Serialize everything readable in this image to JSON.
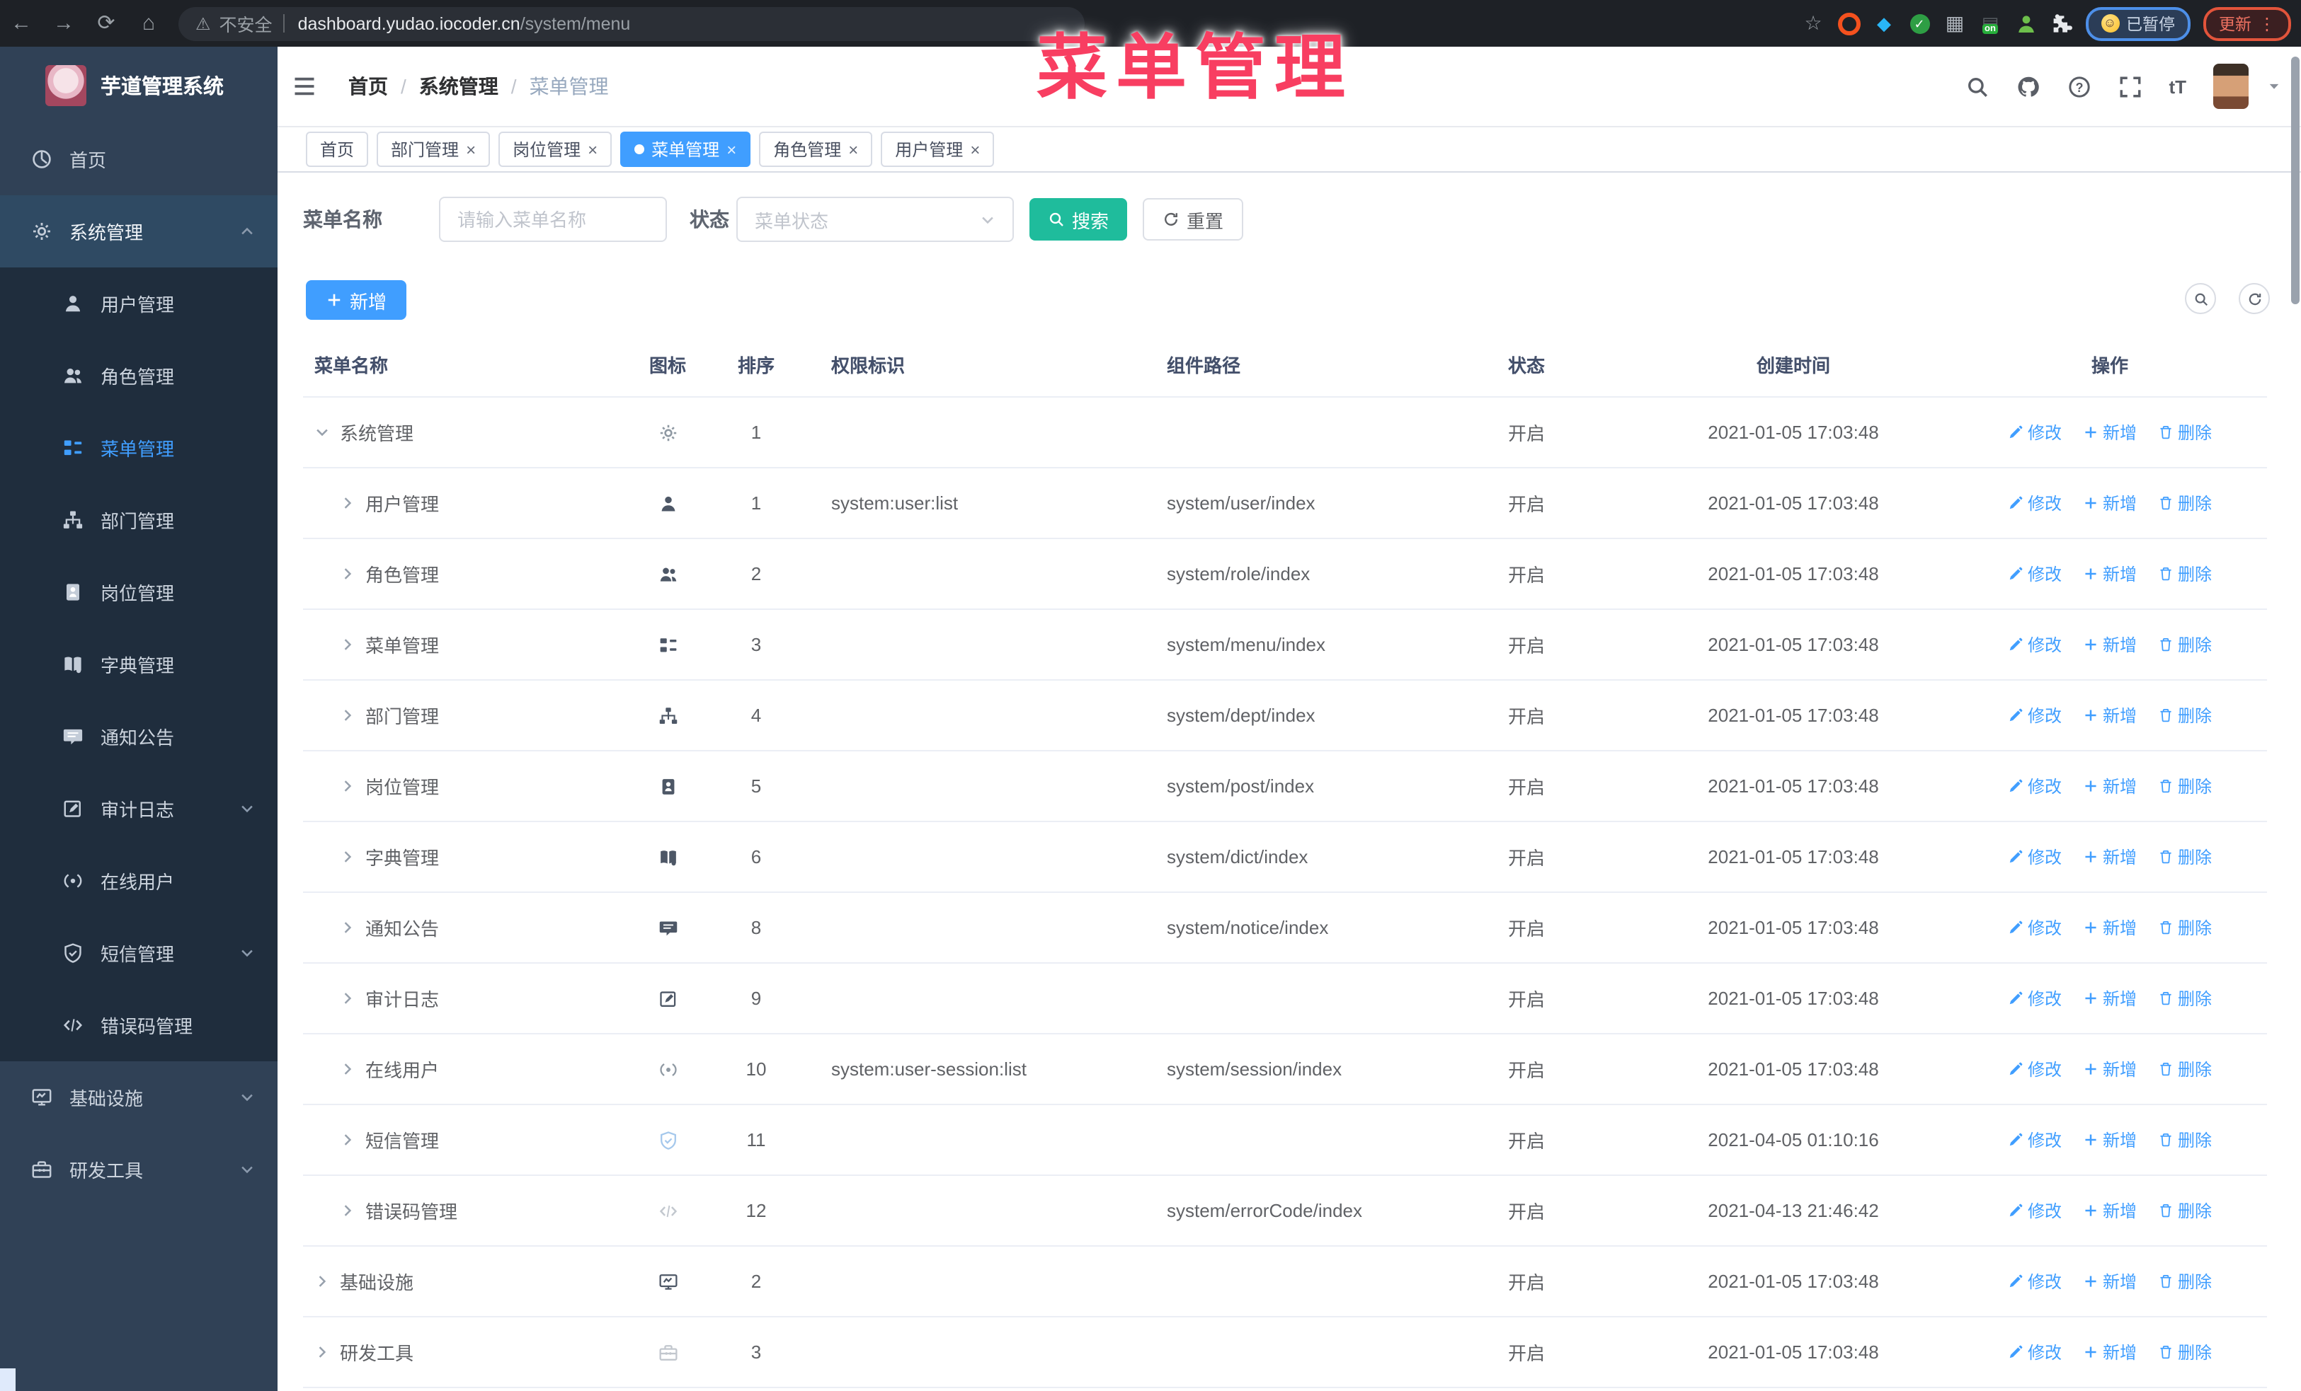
{
  "browser": {
    "security_label": "不安全",
    "url_domain": "dashboard.yudao.iocoder.cn",
    "url_path": "/system/menu",
    "paused_label": "已暂停",
    "update_label": "更新",
    "on_badge": "on"
  },
  "overlay": {
    "title": "菜单管理",
    "color": "#f83e61"
  },
  "sidebar": {
    "logo_title": "芋道管理系统",
    "items": [
      {
        "key": "home",
        "label": "首页",
        "icon": "dashboard",
        "level": 1
      },
      {
        "key": "system",
        "label": "系统管理",
        "icon": "gear",
        "level": 1,
        "arrow": "up",
        "parent_active": true
      },
      {
        "key": "user",
        "label": "用户管理",
        "icon": "user",
        "level": 2
      },
      {
        "key": "role",
        "label": "角色管理",
        "icon": "users",
        "level": 2
      },
      {
        "key": "menu",
        "label": "菜单管理",
        "icon": "tree",
        "level": 2,
        "active": true
      },
      {
        "key": "dept",
        "label": "部门管理",
        "icon": "org",
        "level": 2
      },
      {
        "key": "post",
        "label": "岗位管理",
        "icon": "badge",
        "level": 2
      },
      {
        "key": "dict",
        "label": "字典管理",
        "icon": "book",
        "level": 2
      },
      {
        "key": "notice",
        "label": "通知公告",
        "icon": "message",
        "level": 2
      },
      {
        "key": "audit",
        "label": "审计日志",
        "icon": "edit",
        "level": 2,
        "arrow": "down"
      },
      {
        "key": "online",
        "label": "在线用户",
        "icon": "link",
        "level": 2
      },
      {
        "key": "sms",
        "label": "短信管理",
        "icon": "shield",
        "level": 2,
        "arrow": "down"
      },
      {
        "key": "errcode",
        "label": "错误码管理",
        "icon": "code",
        "level": 2
      },
      {
        "key": "infra",
        "label": "基础设施",
        "icon": "monitor",
        "level": 1,
        "arrow": "down"
      },
      {
        "key": "tools",
        "label": "研发工具",
        "icon": "toolbox",
        "level": 1,
        "arrow": "down"
      }
    ]
  },
  "header": {
    "breadcrumb": [
      "首页",
      "系统管理",
      "菜单管理"
    ]
  },
  "tabs": [
    {
      "label": "首页",
      "closable": false,
      "active": false
    },
    {
      "label": "部门管理",
      "closable": true,
      "active": false
    },
    {
      "label": "岗位管理",
      "closable": true,
      "active": false
    },
    {
      "label": "菜单管理",
      "closable": true,
      "active": true
    },
    {
      "label": "角色管理",
      "closable": true,
      "active": false
    },
    {
      "label": "用户管理",
      "closable": true,
      "active": false
    }
  ],
  "filters": {
    "name_label": "菜单名称",
    "name_placeholder": "请输入菜单名称",
    "status_label": "状态",
    "status_placeholder": "菜单状态",
    "search_label": "搜索",
    "reset_label": "重置"
  },
  "toolbar": {
    "add_label": "新增"
  },
  "table": {
    "columns": [
      "菜单名称",
      "图标",
      "排序",
      "权限标识",
      "组件路径",
      "状态",
      "创建时间",
      "操作"
    ],
    "actions": {
      "edit": "修改",
      "add": "新增",
      "delete": "删除"
    },
    "rows": [
      {
        "name": "系统管理",
        "level": 1,
        "expand": "open",
        "icon": "gear",
        "tone": "gray",
        "sort": "1",
        "perm": "",
        "path": "",
        "status": "开启",
        "time": "2021-01-05 17:03:48"
      },
      {
        "name": "用户管理",
        "level": 2,
        "expand": "closed",
        "icon": "user",
        "tone": "dark",
        "sort": "1",
        "perm": "system:user:list",
        "path": "system/user/index",
        "status": "开启",
        "time": "2021-01-05 17:03:48"
      },
      {
        "name": "角色管理",
        "level": 2,
        "expand": "closed",
        "icon": "users",
        "tone": "dark",
        "sort": "2",
        "perm": "",
        "path": "system/role/index",
        "status": "开启",
        "time": "2021-01-05 17:03:48"
      },
      {
        "name": "菜单管理",
        "level": 2,
        "expand": "closed",
        "icon": "tree",
        "tone": "dark",
        "sort": "3",
        "perm": "",
        "path": "system/menu/index",
        "status": "开启",
        "time": "2021-01-05 17:03:48"
      },
      {
        "name": "部门管理",
        "level": 2,
        "expand": "closed",
        "icon": "org",
        "tone": "dark",
        "sort": "4",
        "perm": "",
        "path": "system/dept/index",
        "status": "开启",
        "time": "2021-01-05 17:03:48"
      },
      {
        "name": "岗位管理",
        "level": 2,
        "expand": "closed",
        "icon": "badge",
        "tone": "dark",
        "sort": "5",
        "perm": "",
        "path": "system/post/index",
        "status": "开启",
        "time": "2021-01-05 17:03:48"
      },
      {
        "name": "字典管理",
        "level": 2,
        "expand": "closed",
        "icon": "book",
        "tone": "dark",
        "sort": "6",
        "perm": "",
        "path": "system/dict/index",
        "status": "开启",
        "time": "2021-01-05 17:03:48"
      },
      {
        "name": "通知公告",
        "level": 2,
        "expand": "closed",
        "icon": "message",
        "tone": "dark",
        "sort": "8",
        "perm": "",
        "path": "system/notice/index",
        "status": "开启",
        "time": "2021-01-05 17:03:48"
      },
      {
        "name": "审计日志",
        "level": 2,
        "expand": "closed",
        "icon": "edit",
        "tone": "dark",
        "sort": "9",
        "perm": "",
        "path": "",
        "status": "开启",
        "time": "2021-01-05 17:03:48"
      },
      {
        "name": "在线用户",
        "level": 2,
        "expand": "closed",
        "icon": "link",
        "tone": "gray",
        "sort": "10",
        "perm": "system:user-session:list",
        "path": "system/session/index",
        "status": "开启",
        "time": "2021-01-05 17:03:48"
      },
      {
        "name": "短信管理",
        "level": 2,
        "expand": "closed",
        "icon": "shield",
        "tone": "blue",
        "sort": "11",
        "perm": "",
        "path": "",
        "status": "开启",
        "time": "2021-04-05 01:10:16"
      },
      {
        "name": "错误码管理",
        "level": 2,
        "expand": "closed",
        "icon": "code",
        "tone": "light",
        "sort": "12",
        "perm": "",
        "path": "system/errorCode/index",
        "status": "开启",
        "time": "2021-04-13 21:46:42"
      },
      {
        "name": "基础设施",
        "level": 1,
        "expand": "closed",
        "icon": "monitor",
        "tone": "dark",
        "sort": "2",
        "perm": "",
        "path": "",
        "status": "开启",
        "time": "2021-01-05 17:03:48"
      },
      {
        "name": "研发工具",
        "level": 1,
        "expand": "closed",
        "icon": "toolbox",
        "tone": "light",
        "sort": "3",
        "perm": "",
        "path": "",
        "status": "开启",
        "time": "2021-01-05 17:03:48"
      }
    ]
  }
}
